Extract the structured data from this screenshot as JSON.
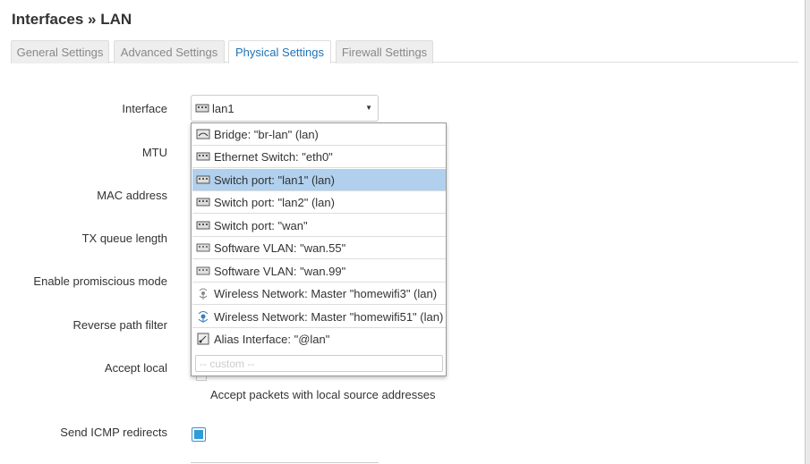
{
  "dialog": {
    "title": "Interfaces » LAN",
    "tabs": [
      {
        "label": "General Settings"
      },
      {
        "label": "Advanced Settings"
      },
      {
        "label": "Physical Settings"
      },
      {
        "label": "Firewall Settings"
      }
    ],
    "active_tab": "Physical Settings"
  },
  "form": {
    "labels": {
      "interface": "Interface",
      "mtu": "MTU",
      "mac": "MAC address",
      "txqueue": "TX queue length",
      "promisc": "Enable promiscious mode",
      "rpfilter": "Reverse path filter",
      "acceptlocal": "Accept local",
      "sendredirects": "Send ICMP redirects"
    },
    "interface_value": "lan1",
    "accept_local_hint": "Accept packets with local source addresses",
    "send_redirects_checked": true
  },
  "dropdown": {
    "options": [
      {
        "label": "Bridge: \"br-lan\" (lan)",
        "icon": "bridge-icon"
      },
      {
        "label": "Ethernet Switch: \"eth0\"",
        "icon": "switch-icon"
      },
      {
        "label": "Switch port: \"lan1\" (lan)",
        "icon": "port-icon",
        "selected": true
      },
      {
        "label": "Switch port: \"lan2\" (lan)",
        "icon": "port-icon"
      },
      {
        "label": "Switch port: \"wan\"",
        "icon": "port-icon"
      },
      {
        "label": "Software VLAN: \"wan.55\"",
        "icon": "vlan-icon"
      },
      {
        "label": "Software VLAN: \"wan.99\"",
        "icon": "vlan-icon"
      },
      {
        "label": "Wireless Network: Master \"homewifi3\" (lan)",
        "icon": "wifi-icon"
      },
      {
        "label": "Wireless Network: Master \"homewifi51\" (lan)",
        "icon": "wifi-icon"
      },
      {
        "label": "Alias Interface: \"@lan\"",
        "icon": "alias-icon"
      }
    ],
    "custom_placeholder": "-- custom --"
  },
  "colors": {
    "accent": "#1f73b7",
    "selected_row": "#b0d0ee",
    "checkbox": "#2f9bd8"
  }
}
